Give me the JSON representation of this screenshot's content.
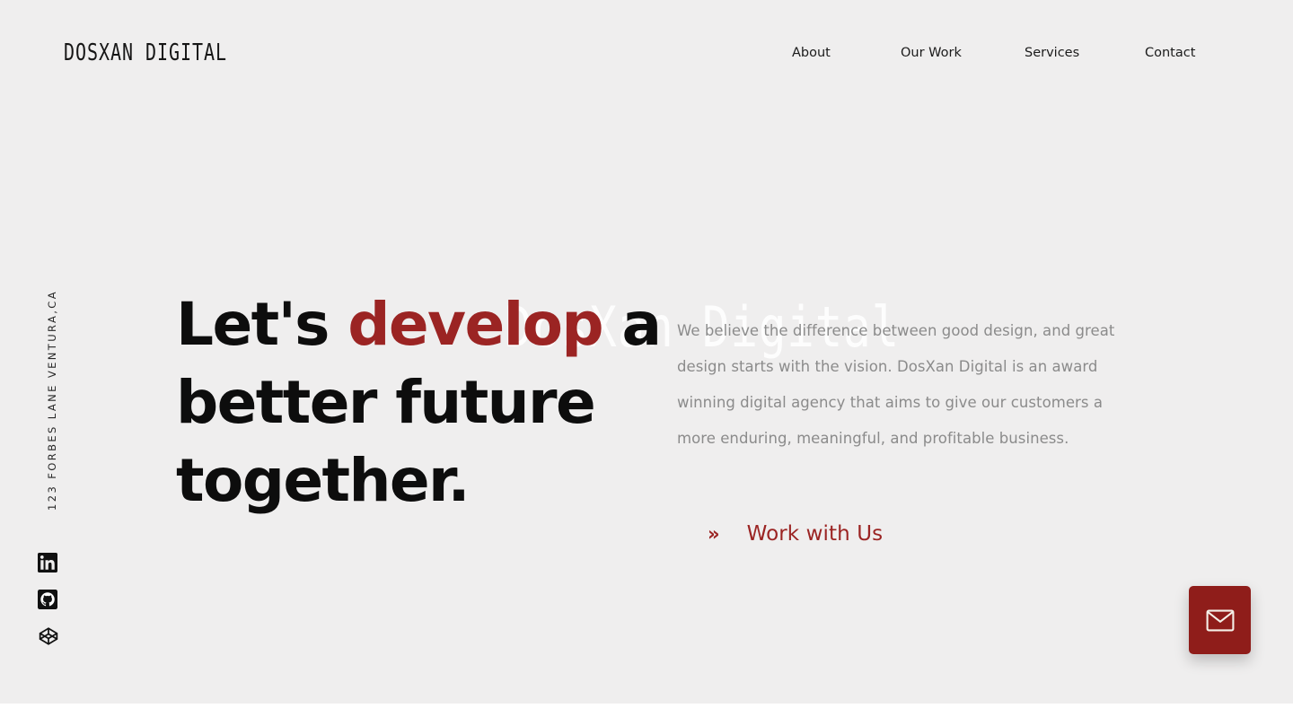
{
  "header": {
    "logo_text": "DosXan Digital",
    "nav": [
      {
        "label": "About",
        "name": "nav-link-about"
      },
      {
        "label": "Our Work",
        "name": "nav-link-our-work"
      },
      {
        "label": "Services",
        "name": "nav-link-services"
      },
      {
        "label": "Contact",
        "name": "nav-link-contact"
      }
    ]
  },
  "left_rail": {
    "address": "123 FORBES LANE VENTURA,CA",
    "social": [
      {
        "icon": "linkedin-icon"
      },
      {
        "icon": "github-icon"
      },
      {
        "icon": "codepen-icon"
      }
    ]
  },
  "hero": {
    "watermark_text": "DosXan Digital",
    "headline_part1": "Let's ",
    "headline_accent": "develop",
    "headline_part2": " a better future together.",
    "paragraph": "We believe the difference between good design, and great design starts with the vision. DosXan Digital is an award winning digital agency that aims to give our customers a more enduring, meaningful, and profitable business.",
    "cta_icon": "»",
    "cta_label": "Work with Us"
  },
  "floating_action": {
    "icon": "envelope-icon",
    "label": "Email us"
  },
  "colors": {
    "background": "#efeeee",
    "accent_red": "#9b2423",
    "fab_red": "#8f1d1a",
    "body_text": "#8b8b8b",
    "heading_text": "#0d0d0d",
    "icon_cream": "#f5f0e8"
  }
}
